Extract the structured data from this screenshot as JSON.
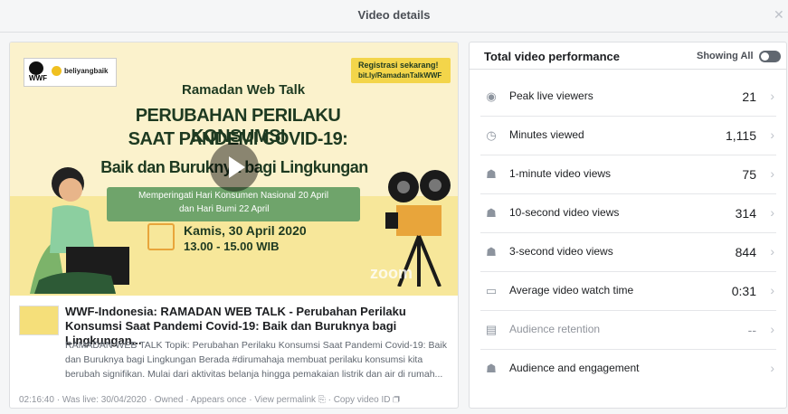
{
  "header": {
    "title": "Video details",
    "close_icon": "close-icon"
  },
  "video": {
    "thumbnail": {
      "logo_wwf": "WWF",
      "logo_partner": "beliyangbaik",
      "registration_line1": "Registrasi sekarang!",
      "registration_line2": "bit.ly/RamadanTalkWWF",
      "subtitle": "Ramadan Web Talk",
      "headline_line1": "PERUBAHAN PERILAKU KONSUMSI",
      "headline_line2": "SAAT PANDEMI COVID-19:",
      "headline_line3": "Baik dan Buruknya bagi Lingkungan",
      "band_line1": "Memperingati Hari Konsumen Nasional 20 April",
      "band_line2": "dan Hari Bumi 22 April",
      "date": "Kamis, 30 April 2020",
      "time": "13.00 - 15.00 WIB",
      "watermark": "zoom"
    },
    "title": "WWF-Indonesia: RAMADAN WEB TALK - Perubahan Perilaku Konsumsi Saat Pandemi Covid-19: Baik dan Buruknya bagi Lingkungan...",
    "description": "RAMADAN WEB TALK Topik: Perubahan Perilaku Konsumsi Saat Pandemi Covid-19: Baik dan Buruknya bagi Lingkungan Berada #dirumahaja membuat perilaku konsumsi kita berubah signifikan. Mulai dari aktivitas belanja hingga pemakaian listrik dan air di rumah...",
    "meta": {
      "duration": "02:16:40",
      "was_live": "Was live: 30/04/2020",
      "owned": "Owned",
      "appears": "Appears once",
      "permalink": "View permalink",
      "copy_id": "Copy video ID",
      "separator": " · "
    }
  },
  "performance": {
    "title": "Total video performance",
    "showing": "Showing All",
    "rows": [
      {
        "icon": "eye-icon",
        "label": "Peak live viewers",
        "value": "21"
      },
      {
        "icon": "clock-icon",
        "label": "Minutes viewed",
        "value": "1,115"
      },
      {
        "icon": "people-icon",
        "label": "1-minute video views",
        "value": "75"
      },
      {
        "icon": "people-icon",
        "label": "10-second video views",
        "value": "314"
      },
      {
        "icon": "people-icon",
        "label": "3-second video views",
        "value": "844"
      },
      {
        "icon": "video-icon",
        "label": "Average video watch time",
        "value": "0:31"
      },
      {
        "icon": "film-icon",
        "label": "Audience retention",
        "value": "--"
      },
      {
        "icon": "audience-icon",
        "label": "Audience and engagement",
        "value": ""
      }
    ]
  }
}
